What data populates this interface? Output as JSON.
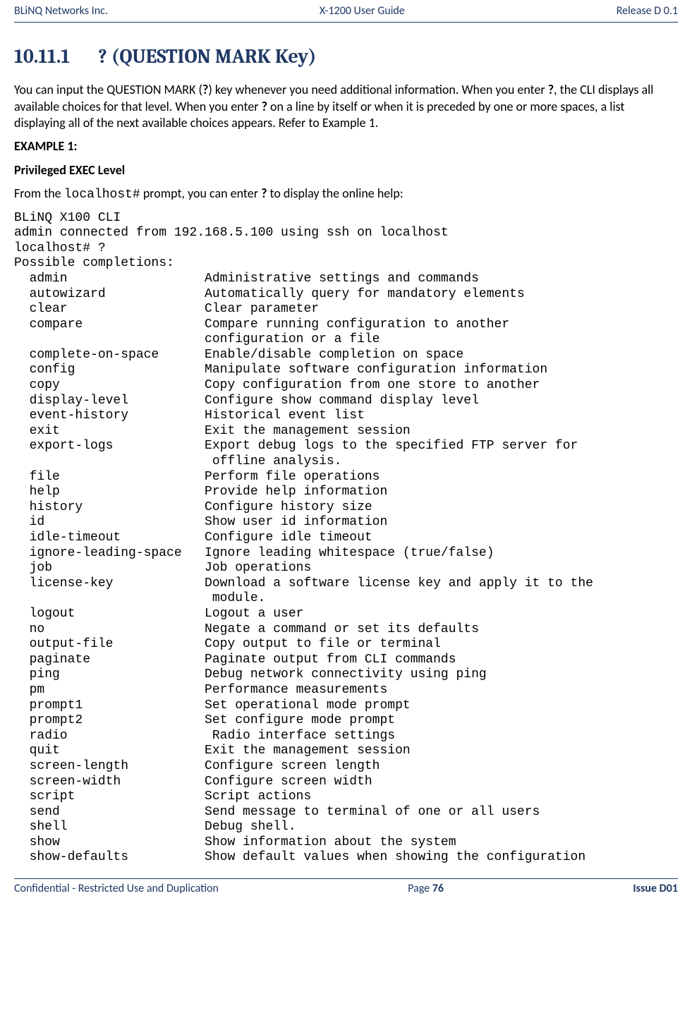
{
  "header": {
    "left": "BLiNQ Networks Inc.",
    "center": "X-1200 User Guide",
    "right": "Release D 0.1"
  },
  "section": {
    "number": "10.11.1",
    "title": "? (QUESTION MARK Key)"
  },
  "paragraph1_parts": {
    "p1": "You can input the QUESTION MARK (",
    "p2": "?",
    "p3": ") key whenever you need additional information. When you enter ",
    "p4": "?",
    "p5": ", the CLI displays all available choices for that level. When you enter ",
    "p6": "?",
    "p7": " on a line by itself or when it is preceded by one or more spaces, a list displaying all of the next available choices appears. Refer to Example 1."
  },
  "example_label": "EXAMPLE 1:",
  "level_label": "Privileged EXEC Level",
  "prompt_line": {
    "p1": "From the ",
    "p2": "localhost#",
    "p3": " prompt, you can enter ",
    "p4": "?",
    "p5": " to display the online help:"
  },
  "cli_output": "BLiNQ X100 CLI\nadmin connected from 192.168.5.100 using ssh on localhost\nlocalhost# ?\nPossible completions:\n  admin                  Administrative settings and commands\n  autowizard             Automatically query for mandatory elements\n  clear                  Clear parameter\n  compare                Compare running configuration to another\n                         configuration or a file\n  complete-on-space      Enable/disable completion on space\n  config                 Manipulate software configuration information\n  copy                   Copy configuration from one store to another\n  display-level          Configure show command display level\n  event-history          Historical event list\n  exit                   Exit the management session\n  export-logs            Export debug logs to the specified FTP server for\n                          offline analysis.\n  file                   Perform file operations\n  help                   Provide help information\n  history                Configure history size\n  id                     Show user id information\n  idle-timeout           Configure idle timeout\n  ignore-leading-space   Ignore leading whitespace (true/false)\n  job                    Job operations\n  license-key            Download a software license key and apply it to the\n                          module.\n  logout                 Logout a user\n  no                     Negate a command or set its defaults\n  output-file            Copy output to file or terminal\n  paginate               Paginate output from CLI commands\n  ping                   Debug network connectivity using ping\n  pm                     Performance measurements\n  prompt1                Set operational mode prompt\n  prompt2                Set configure mode prompt\n  radio                   Radio interface settings\n  quit                   Exit the management session\n  screen-length          Configure screen length\n  screen-width           Configure screen width\n  script                 Script actions\n  send                   Send message to terminal of one or all users\n  shell                  Debug shell.\n  show                   Show information about the system\n  show-defaults          Show default values when showing the configuration",
  "footer": {
    "left": "Confidential - Restricted Use and Duplication",
    "page_prefix": "Page ",
    "page_number": "76",
    "right": "Issue D01"
  }
}
